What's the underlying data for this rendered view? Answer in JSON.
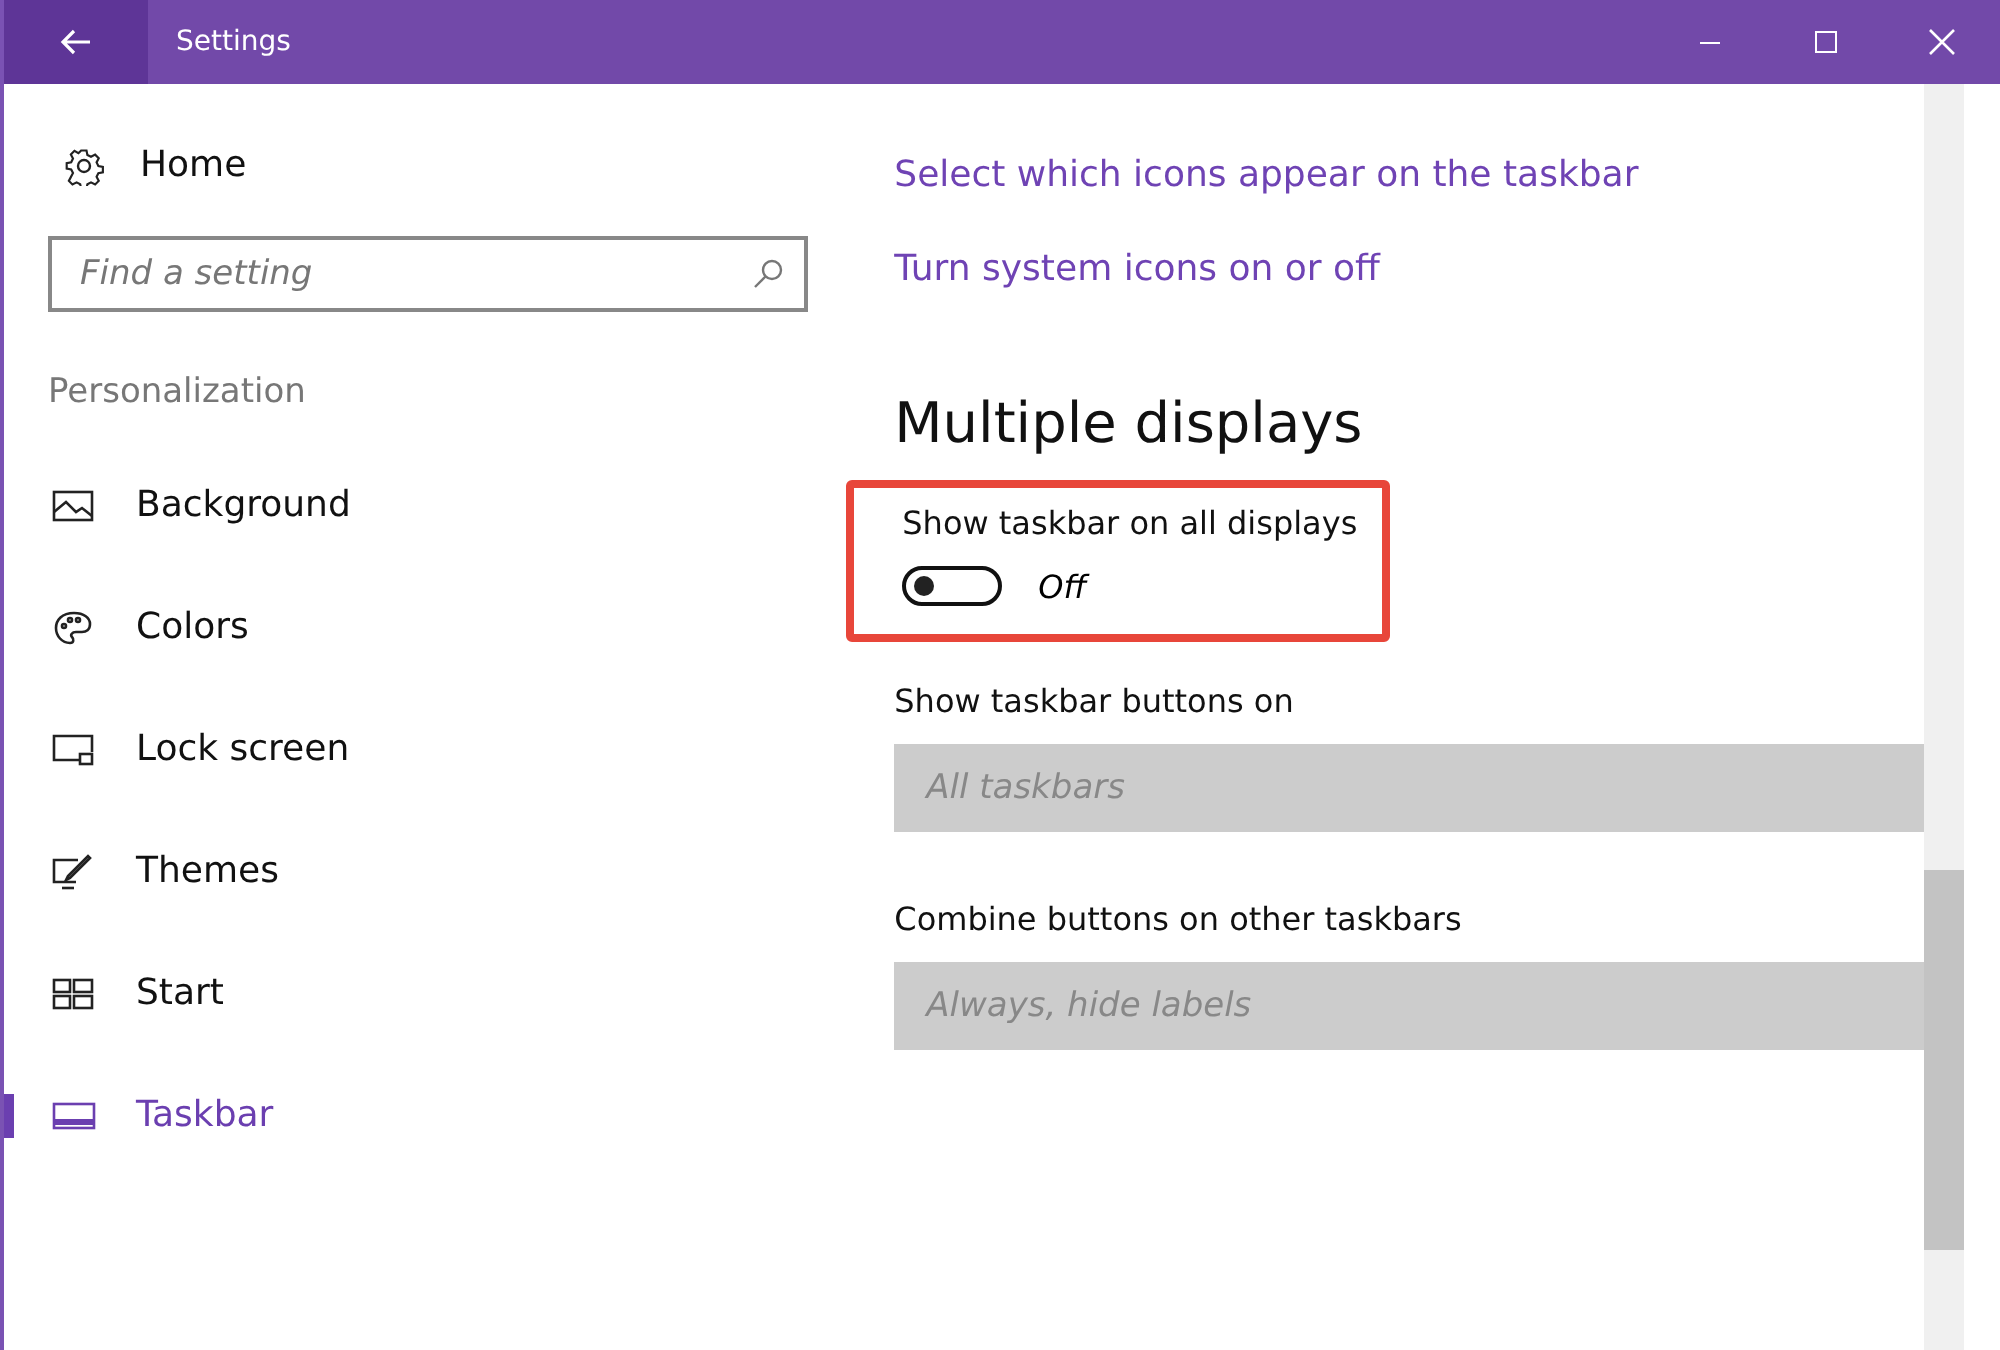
{
  "window": {
    "title": "Settings"
  },
  "sidebar": {
    "home": "Home",
    "search": {
      "placeholder": "Find a setting"
    },
    "section": "Personalization",
    "items": [
      {
        "label": "Background",
        "selected": false
      },
      {
        "label": "Colors",
        "selected": false
      },
      {
        "label": "Lock screen",
        "selected": false
      },
      {
        "label": "Themes",
        "selected": false
      },
      {
        "label": "Start",
        "selected": false
      },
      {
        "label": "Taskbar",
        "selected": true
      }
    ]
  },
  "content": {
    "links": [
      "Select which icons appear on the taskbar",
      "Turn system icons on or off"
    ],
    "heading": "Multiple displays",
    "toggle": {
      "label": "Show taskbar on all displays",
      "on": false,
      "state_text": "Off",
      "highlighted": true
    },
    "dropdowns": [
      {
        "label": "Show taskbar buttons on",
        "value": "All taskbars",
        "disabled": true
      },
      {
        "label": "Combine buttons on other taskbars",
        "value": "Always, hide labels",
        "disabled": true
      }
    ]
  }
}
